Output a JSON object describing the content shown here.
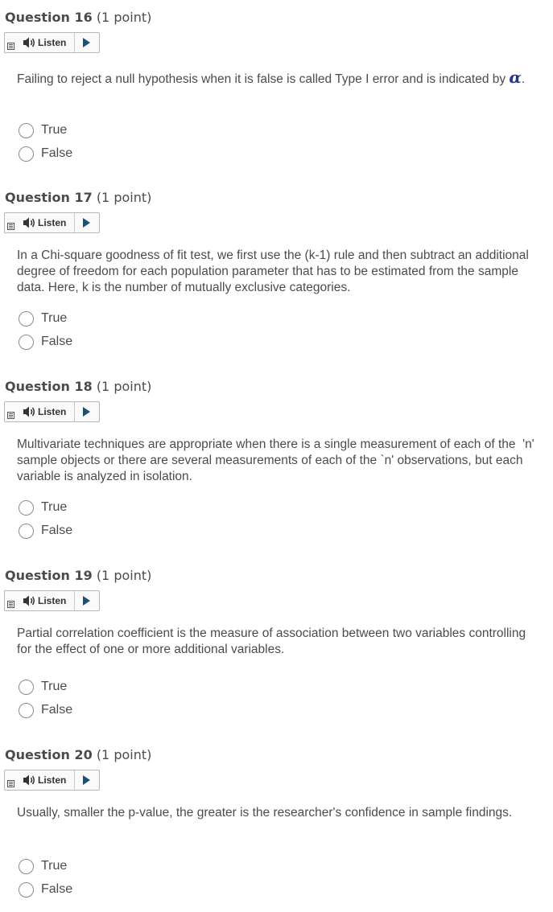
{
  "listen_label": "Listen",
  "questions": [
    {
      "title": "Question 16",
      "points": "(1 point)",
      "text_before": "Failing to reject a null hypothesis when it is false is called Type I error and is indicated by ",
      "symbol": "α",
      "text_after": ".",
      "options": [
        "True",
        "False"
      ]
    },
    {
      "title": "Question 17",
      "points": "(1 point)",
      "text": "In a Chi-square goodness of fit test, we first use the (k-1) rule and then subtract an additional degree of freedom for each population parameter that has to be estimated from the sample data. Here, k is the number of mutually exclusive categories.",
      "options": [
        "True",
        "False"
      ]
    },
    {
      "title": "Question 18",
      "points": "(1 point)",
      "text": "Multivariate techniques are appropriate when there is a single measurement of each of the  'n' sample objects or there are several measurements of each of the `n' observations, but each variable is analyzed in isolation.",
      "options": [
        "True",
        "False"
      ]
    },
    {
      "title": "Question 19",
      "points": "(1 point)",
      "text": "Partial correlation coefficient is the measure of association between two variables controlling for the effect of one or more additional variables.",
      "options": [
        "True",
        "False"
      ]
    },
    {
      "title": "Question 20",
      "points": "(1 point)",
      "text": "Usually, smaller the p-value, the greater is the researcher's confidence in sample findings.",
      "options": [
        "True",
        "False"
      ]
    }
  ]
}
